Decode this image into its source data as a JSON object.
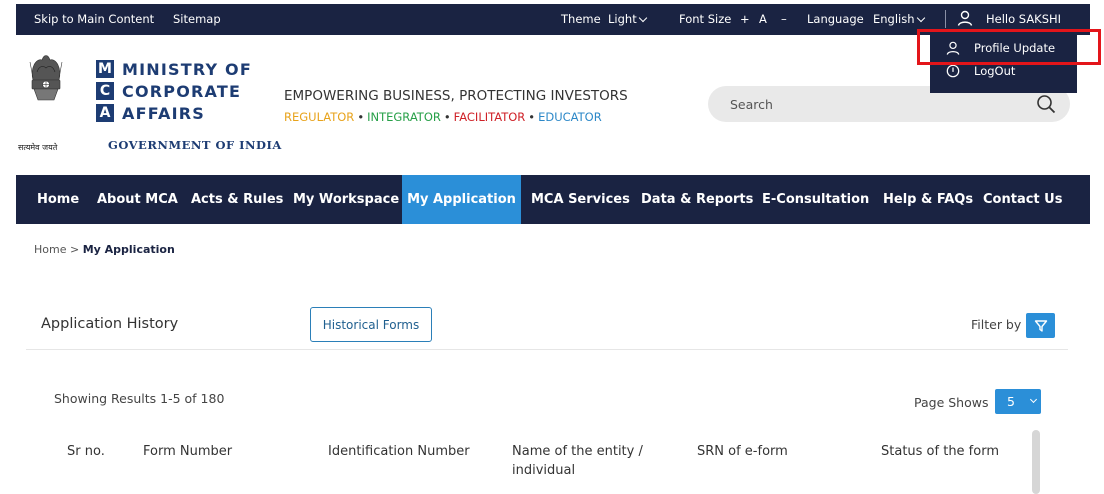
{
  "topbar": {
    "skip": "Skip to Main Content",
    "sitemap": "Sitemap",
    "theme_label": "Theme",
    "theme_value": "Light",
    "font_size_label": "Font Size",
    "font_plus": "+",
    "font_a": "A",
    "font_minus": "–",
    "language_label": "Language",
    "language_value": "English",
    "greeting": "Hello SAKSHI"
  },
  "user_menu": {
    "items": [
      {
        "label": "Profile Update",
        "icon": "user-icon"
      },
      {
        "label": "LogOut",
        "icon": "power-icon"
      }
    ],
    "highlight_color": "#e3151a"
  },
  "header": {
    "emblem_caption": "सत्यमेव जयते",
    "logo_letters": [
      "M",
      "C",
      "A"
    ],
    "logo_words": [
      "MINISTRY OF",
      "CORPORATE",
      "AFFAIRS"
    ],
    "government": "GOVERNMENT OF INDIA",
    "tagline": "EMPOWERING BUSINESS, PROTECTING INVESTORS",
    "subtag": [
      "REGULATOR",
      "INTEGRATOR",
      "FACILITATOR",
      "EDUCATOR"
    ],
    "search_placeholder": "Search"
  },
  "nav": {
    "items": [
      "Home",
      "About MCA",
      "Acts & Rules",
      "My Workspace",
      "My Application",
      "MCA Services",
      "Data & Reports",
      "E-Consultation",
      "Help & FAQs",
      "Contact Us"
    ],
    "active": "My Application"
  },
  "breadcrumb": {
    "home": "Home",
    "separator": ">",
    "current": "My Application"
  },
  "app_history": {
    "title": "Application History",
    "historical_button": "Historical Forms",
    "filter_label": "Filter by",
    "showing": "Showing Results 1-5 of 180",
    "page_shows_label": "Page Shows",
    "page_size": "5",
    "columns": [
      "Sr no.",
      "Form Number",
      "Identification Number",
      "Name of the entity / individual",
      "SRN of e-form",
      "Status of the form"
    ]
  },
  "colors": {
    "navy": "#1a2342",
    "accent_blue": "#2b8fd8",
    "logo_blue": "#1d3c73"
  }
}
